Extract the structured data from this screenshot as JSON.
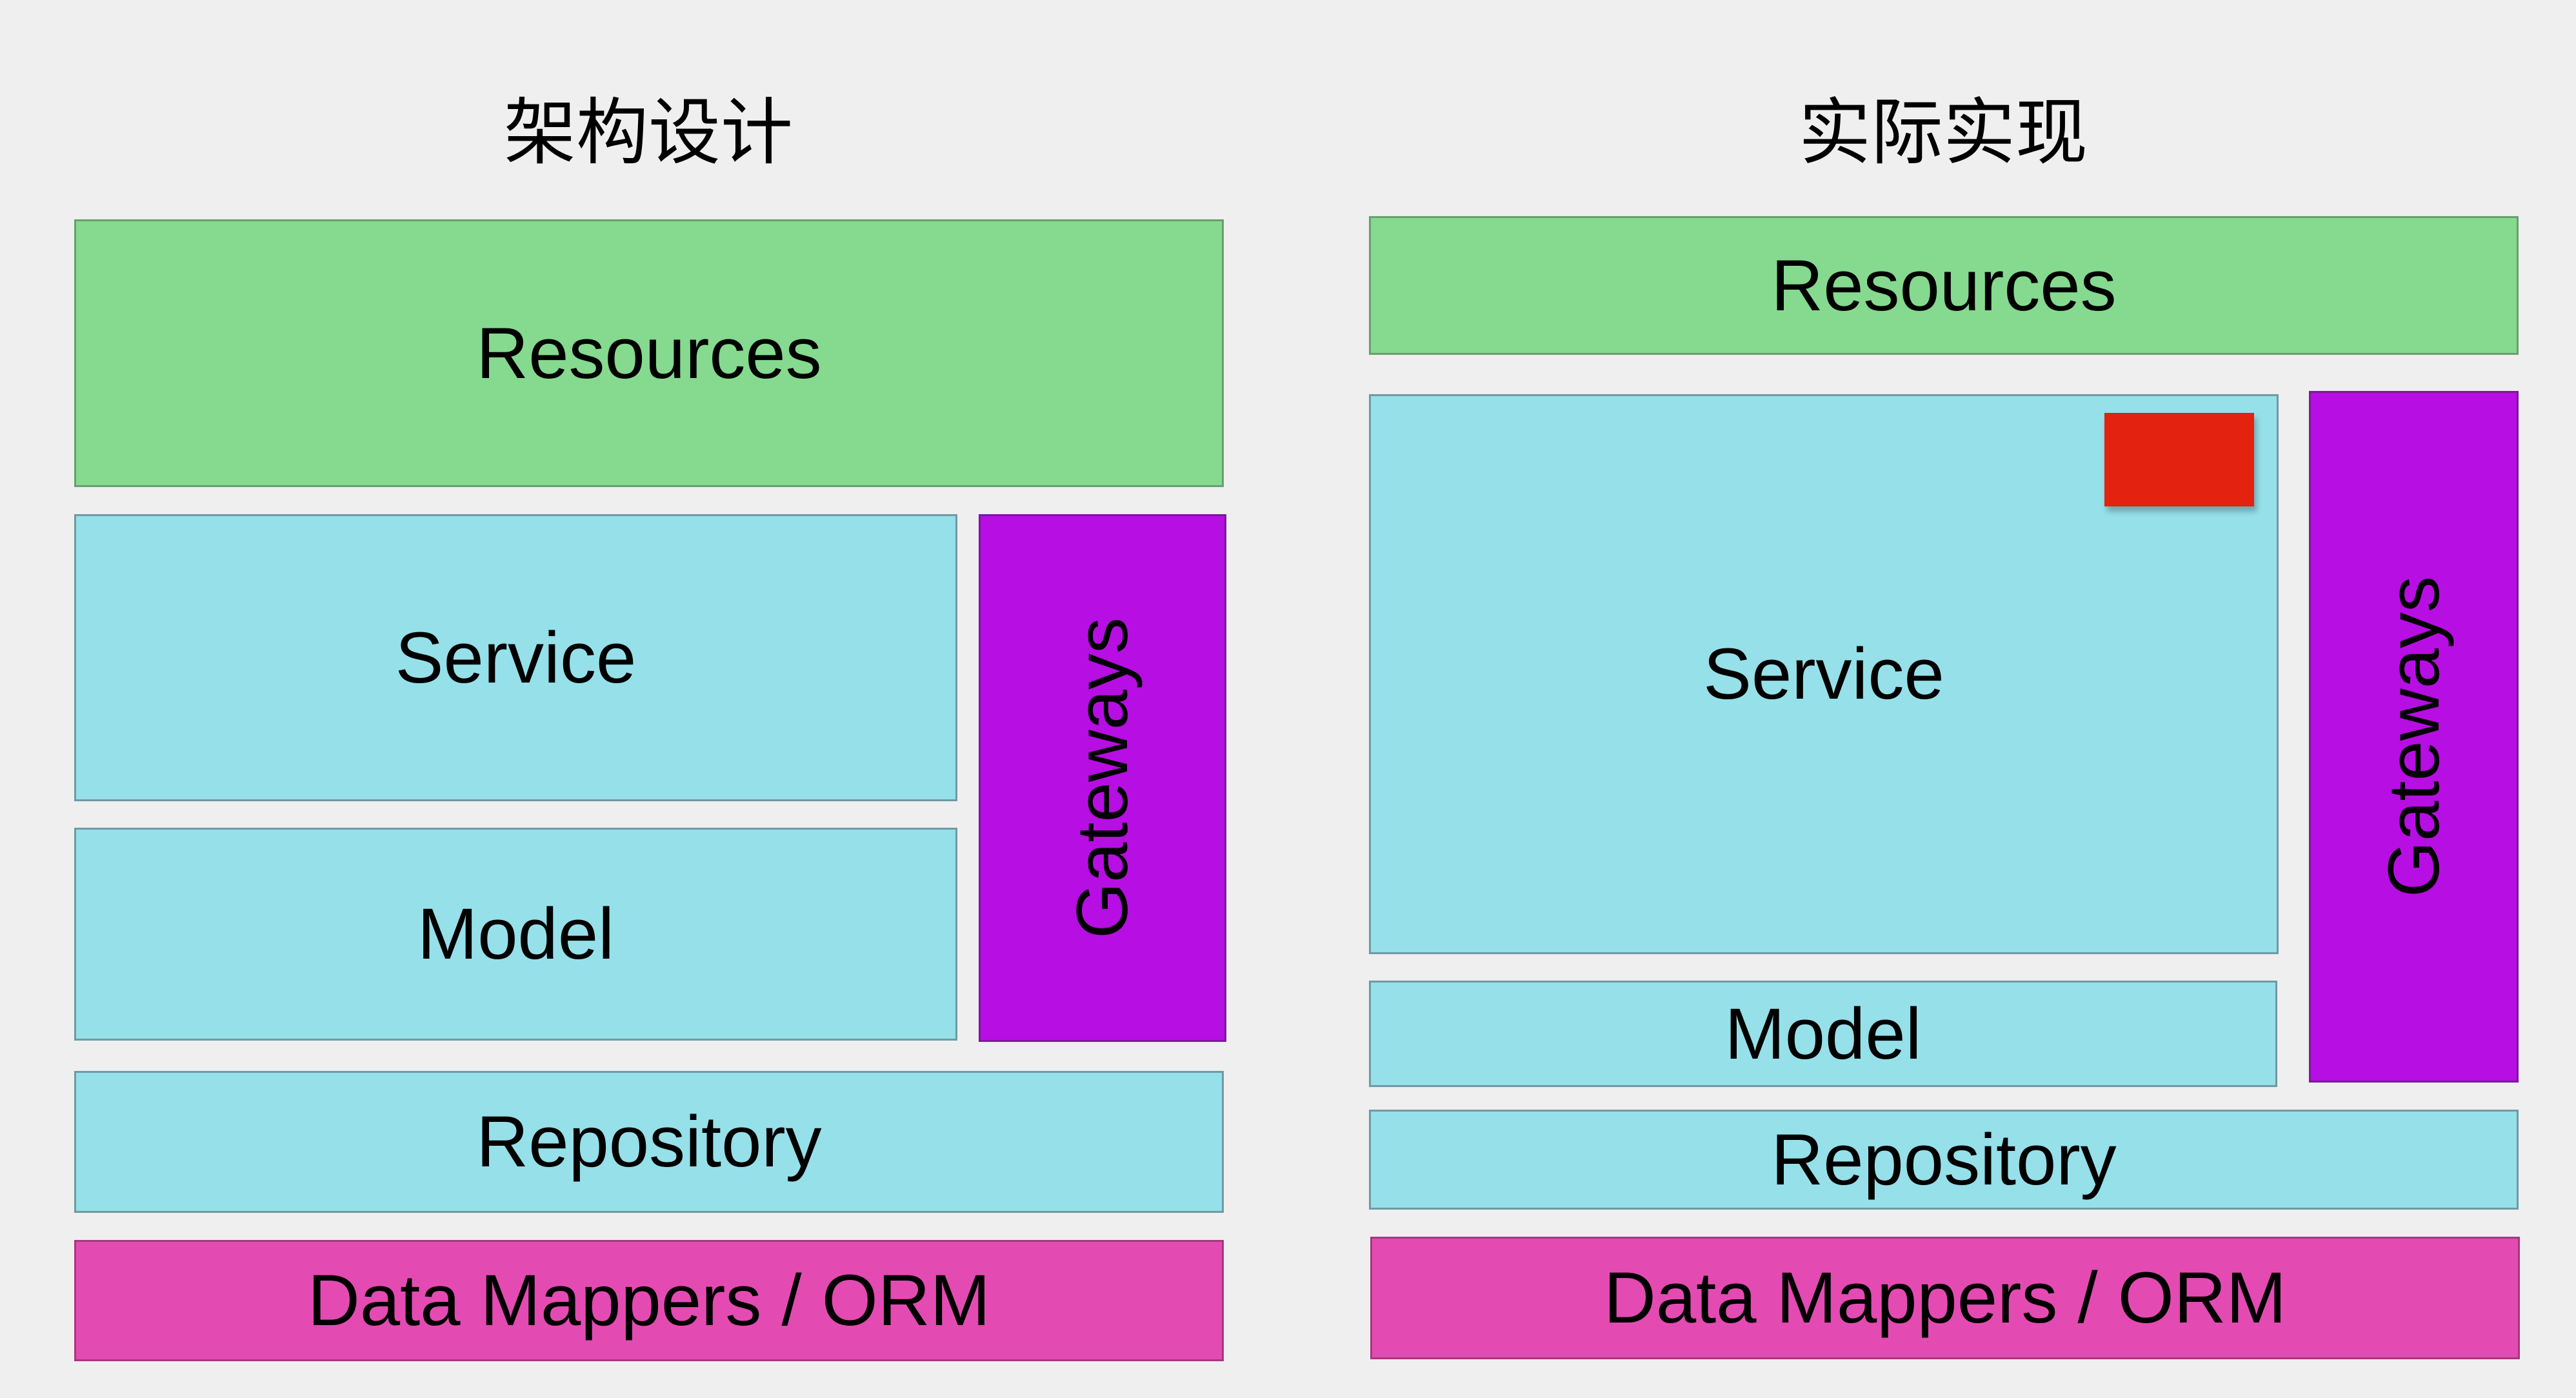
{
  "left": {
    "title": "架构设计",
    "resources": "Resources",
    "service": "Service",
    "model": "Model",
    "gateways": "Gateways",
    "repository": "Repository",
    "data_mappers": "Data Mappers / ORM"
  },
  "right": {
    "title": "实际实现",
    "resources": "Resources",
    "service": "Service",
    "model": "Model",
    "gateways": "Gateways",
    "repository": "Repository",
    "data_mappers": "Data Mappers / ORM"
  },
  "colors": {
    "resources": "#85da8f",
    "service_model_repository": "#96e0ea",
    "gateways": "#b70ee3",
    "data_mappers": "#e34bb2",
    "marker": "#e3220f",
    "background": "#efefef"
  }
}
